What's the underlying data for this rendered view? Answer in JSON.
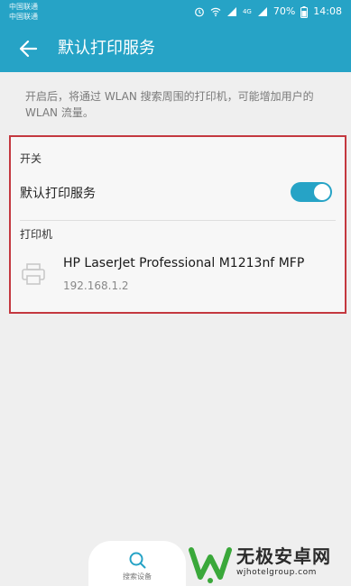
{
  "status_bar": {
    "carrier_1": "中国联通",
    "carrier_2": "中国联通",
    "signal_2": "4G",
    "battery": "70%",
    "time": "14:08"
  },
  "app_bar": {
    "title": "默认打印服务",
    "back_icon": "arrow-left-icon"
  },
  "description": "开启后，将通过 WLAN 搜索周围的打印机，可能增加用户的 WLAN 流量。",
  "switch_section": {
    "header": "开关",
    "service_label": "默认打印服务",
    "service_enabled": true
  },
  "printer_section": {
    "header": "打印机",
    "printers": [
      {
        "name": "HP LaserJet Professional M1213nf MFP",
        "ip": "192.168.1.2",
        "icon": "printer-icon"
      }
    ]
  },
  "bottom_button": {
    "label": "搜索设备",
    "icon": "search-icon"
  },
  "watermark": {
    "brand": "无极安卓网",
    "url": "wjhotelgroup.com"
  },
  "colors": {
    "primary": "#26a3c6",
    "highlight_border": "#c4383f",
    "watermark_green": "#3aa83a"
  }
}
